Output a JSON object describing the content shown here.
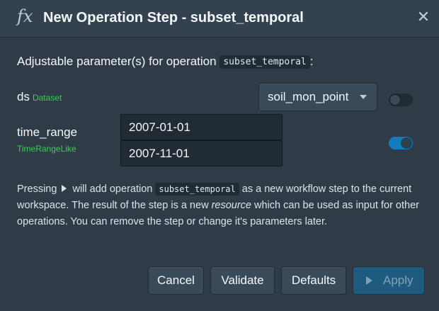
{
  "dialog": {
    "title": "New Operation Step - subset_temporal",
    "icon": "fx-icon",
    "close_symbol": "✕"
  },
  "intro": {
    "prefix": "Adjustable parameter(s) for operation",
    "operation": "subset_temporal",
    "suffix": ":"
  },
  "params": {
    "ds": {
      "name": "ds",
      "type": "Dataset",
      "selected": "soil_mon_point",
      "toggle_on": false
    },
    "time_range": {
      "name": "time_range",
      "type": "TimeRangeLike",
      "start": "2007-01-01",
      "end": "2007-11-01",
      "toggle_on": true
    }
  },
  "description": {
    "part1": "Pressing",
    "part2": "will add operation",
    "operation": "subset_temporal",
    "part3": "as a new workflow step to the current workspace. The result of the step is a new",
    "resource": "resource",
    "part4": "which can be used as input for other operations. You can remove the step or change it's parameters later."
  },
  "buttons": {
    "cancel": "Cancel",
    "validate": "Validate",
    "defaults": "Defaults",
    "apply": "Apply"
  },
  "colors": {
    "background": "#2f3c48",
    "type_label": "#3dcc5a",
    "toggle_on": "#137cbd",
    "apply_disabled": "#1f5a7f"
  }
}
